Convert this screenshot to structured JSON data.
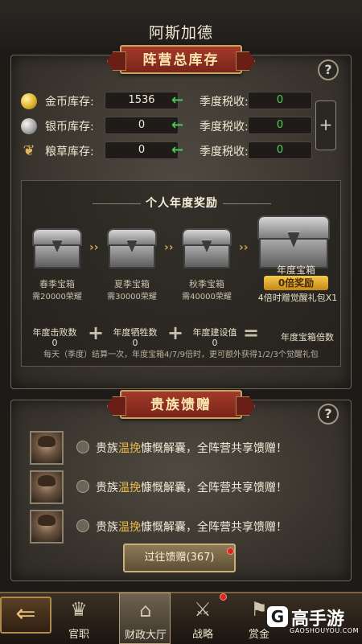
{
  "header": {
    "title": "阿斯加德"
  },
  "inventory": {
    "section_title": "阵营总库存",
    "help": "?",
    "rows": [
      {
        "label": "金币库存:",
        "value": "1536",
        "tax_label": "季度税收:",
        "tax_value": "0",
        "icon": "gold-coin-icon"
      },
      {
        "label": "银币库存:",
        "value": "0",
        "tax_label": "季度税收:",
        "tax_value": "0",
        "icon": "silver-coin-icon"
      },
      {
        "label": "粮草库存:",
        "value": "0",
        "tax_label": "季度税收:",
        "tax_value": "0",
        "icon": "grain-icon"
      }
    ],
    "arrow": "←",
    "add": "+"
  },
  "annual": {
    "title": "个人年度奖励",
    "chests": [
      {
        "name": "春季宝箱",
        "need": "需20000荣耀"
      },
      {
        "name": "夏季宝箱",
        "need": "需30000荣耀"
      },
      {
        "name": "秋季宝箱",
        "need": "需40000荣耀"
      }
    ],
    "annual_chest": {
      "name": "年度宝箱",
      "badge": "0倍奖励",
      "desc": "4倍时赠觉醒礼包X1"
    },
    "formula": {
      "kills_label": "年度击败数",
      "kills_value": "0",
      "sacrifice_label": "年度牺牲数",
      "sacrifice_value": "0",
      "build_label": "年度建设值",
      "build_value": "0",
      "multiplier_label": "年度宝箱倍数"
    },
    "note": "每天（季度）结算一次，年度宝箱4/7/9倍时，更可额外获得1/2/3个觉醒礼包"
  },
  "gifts": {
    "section_title": "贵族馈赠",
    "help": "?",
    "messages": [
      {
        "pre": "贵族",
        "name": "温挽",
        "post": "慷慨解囊，全阵营共享馈赠！"
      },
      {
        "pre": "贵族",
        "name": "温挽",
        "post": "慷慨解囊，全阵营共享馈赠！"
      },
      {
        "pre": "贵族",
        "name": "温挽",
        "post": "慷慨解囊，全阵营共享馈赠！"
      }
    ],
    "history_button": "过往馈赠(367)"
  },
  "bottom_nav": {
    "back": "⇐",
    "items": [
      {
        "label": "官职",
        "icon": "crown-icon"
      },
      {
        "label": "财政大厅",
        "icon": "hall-icon"
      },
      {
        "label": "战略",
        "icon": "strategy-icon"
      },
      {
        "label": "赏金",
        "icon": "bounty-icon"
      }
    ]
  },
  "watermark": {
    "logo": "G",
    "name": "高手游",
    "url": "GAOSHOUYOU.COM"
  }
}
